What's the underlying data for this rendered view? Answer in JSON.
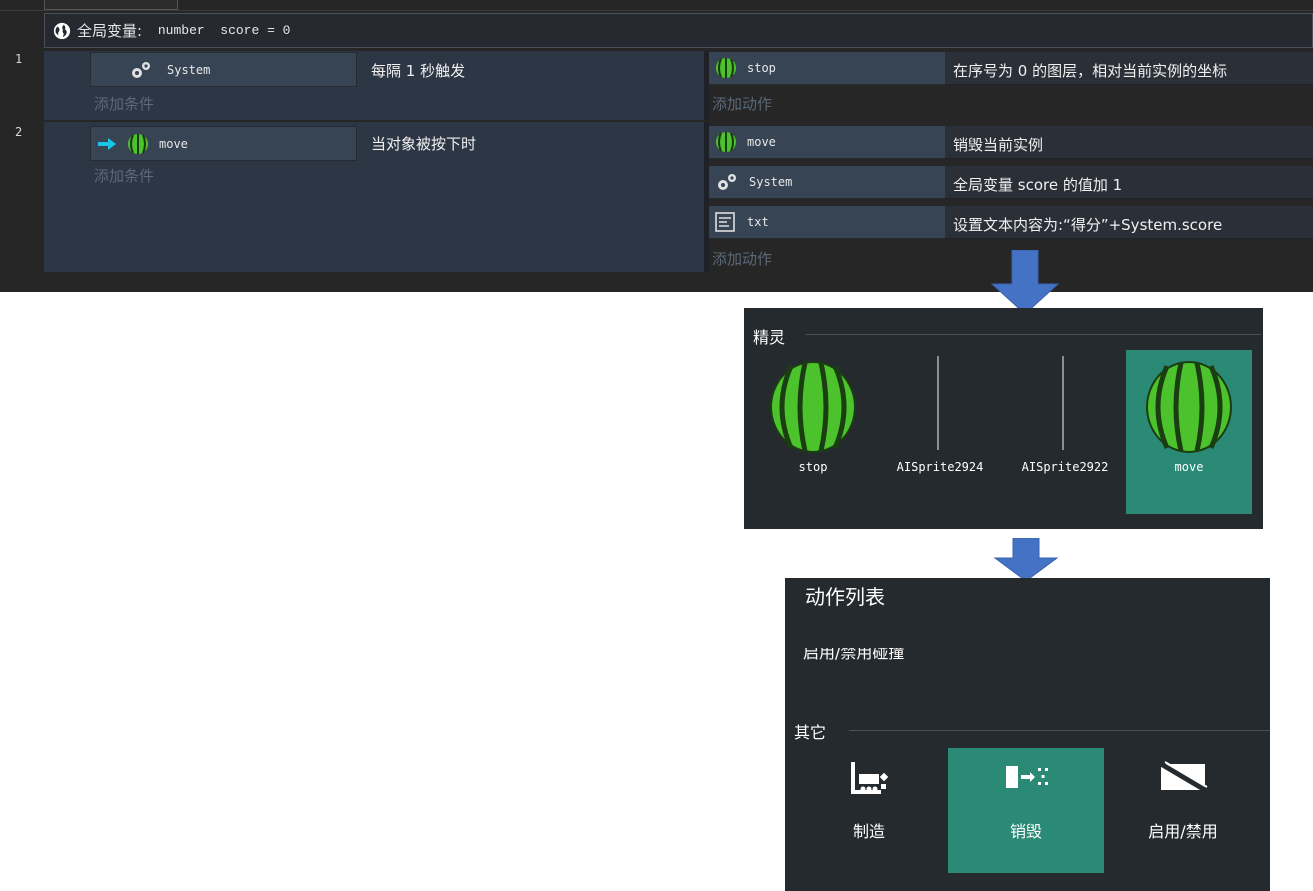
{
  "event_sheet": {
    "global_label": "全局变量:",
    "global_decl": " number  score = 0",
    "events": [
      {
        "number": "1",
        "condition": {
          "object": "System",
          "icon": "gears-icon",
          "text": "每隔 1 秒触发"
        },
        "add_condition": "添加条件",
        "actions": [
          {
            "object": "stop",
            "icon": "watermelon-icon",
            "text": "在序号为 0 的图层，相对当前实例的坐标"
          }
        ],
        "add_action": "添加动作"
      },
      {
        "number": "2",
        "condition": {
          "object": "move",
          "icon": "watermelon-icon",
          "text": "当对象被按下时"
        },
        "add_condition": "添加条件",
        "actions": [
          {
            "object": "move",
            "icon": "watermelon-icon",
            "text": "销毁当前实例"
          },
          {
            "object": "System",
            "icon": "gears-icon",
            "text": "全局变量 score 的值加 1"
          },
          {
            "object": "txt",
            "icon": "text-box-icon",
            "text": "设置文本内容为:“得分”+System.score"
          }
        ],
        "add_action": "添加动作"
      }
    ]
  },
  "sprite_panel": {
    "title": "精灵",
    "sprites": [
      {
        "name": "stop",
        "icon": "watermelon-icon",
        "selected": false
      },
      {
        "name": "AISprite2924",
        "icon": "placeholder-bar",
        "selected": false
      },
      {
        "name": "AISprite2922",
        "icon": "placeholder-bar",
        "selected": false
      },
      {
        "name": "move",
        "icon": "watermelon-icon",
        "selected": true
      }
    ]
  },
  "action_panel": {
    "title": "动作列表",
    "partial_item": "启用/禁用碰撞",
    "section_title": "其它",
    "items": [
      {
        "label": "制造",
        "icon": "spawn-icon",
        "selected": false
      },
      {
        "label": "销毁",
        "icon": "destroy-icon",
        "selected": true
      },
      {
        "label": "启用/禁用",
        "icon": "enable-disable-icon",
        "selected": false
      }
    ]
  },
  "colors": {
    "sheet_bg": "#262626",
    "row_bg": "#384556",
    "selected_green": "#2a8a76",
    "arrow_blue": "#4472c4",
    "cyan_arrow": "#19c3e6"
  }
}
